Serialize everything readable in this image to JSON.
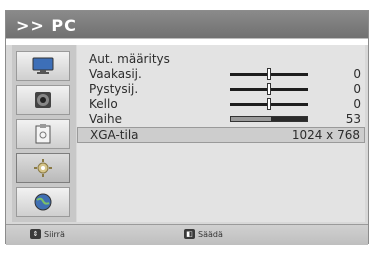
{
  "header": {
    "title": ">> PC"
  },
  "menu": {
    "rows": [
      {
        "label": "Aut. määritys",
        "value": ""
      },
      {
        "label": "Vaakasij.",
        "value": "0",
        "control": "slider",
        "level": 0.5
      },
      {
        "label": "Pystysij.",
        "value": "0",
        "control": "slider",
        "level": 0.5
      },
      {
        "label": "Kello",
        "value": "0",
        "control": "slider",
        "level": 0.5
      },
      {
        "label": "Vaihe",
        "value": "53",
        "control": "bar",
        "level": 0.53
      },
      {
        "label": "XGA-tila",
        "value": "1024 x 768"
      }
    ]
  },
  "sidebar": {
    "items": [
      {
        "icon": "monitor-icon"
      },
      {
        "icon": "speaker-icon"
      },
      {
        "icon": "clipboard-icon"
      },
      {
        "icon": "gear-icon"
      },
      {
        "icon": "globe-icon"
      }
    ]
  },
  "footer": {
    "move_label": "Siirrä",
    "adjust_label": "Säädä"
  },
  "colors": {
    "header": "#7a7a7a",
    "panel": "#e3e3e3",
    "selected": "#cdcdcd"
  }
}
